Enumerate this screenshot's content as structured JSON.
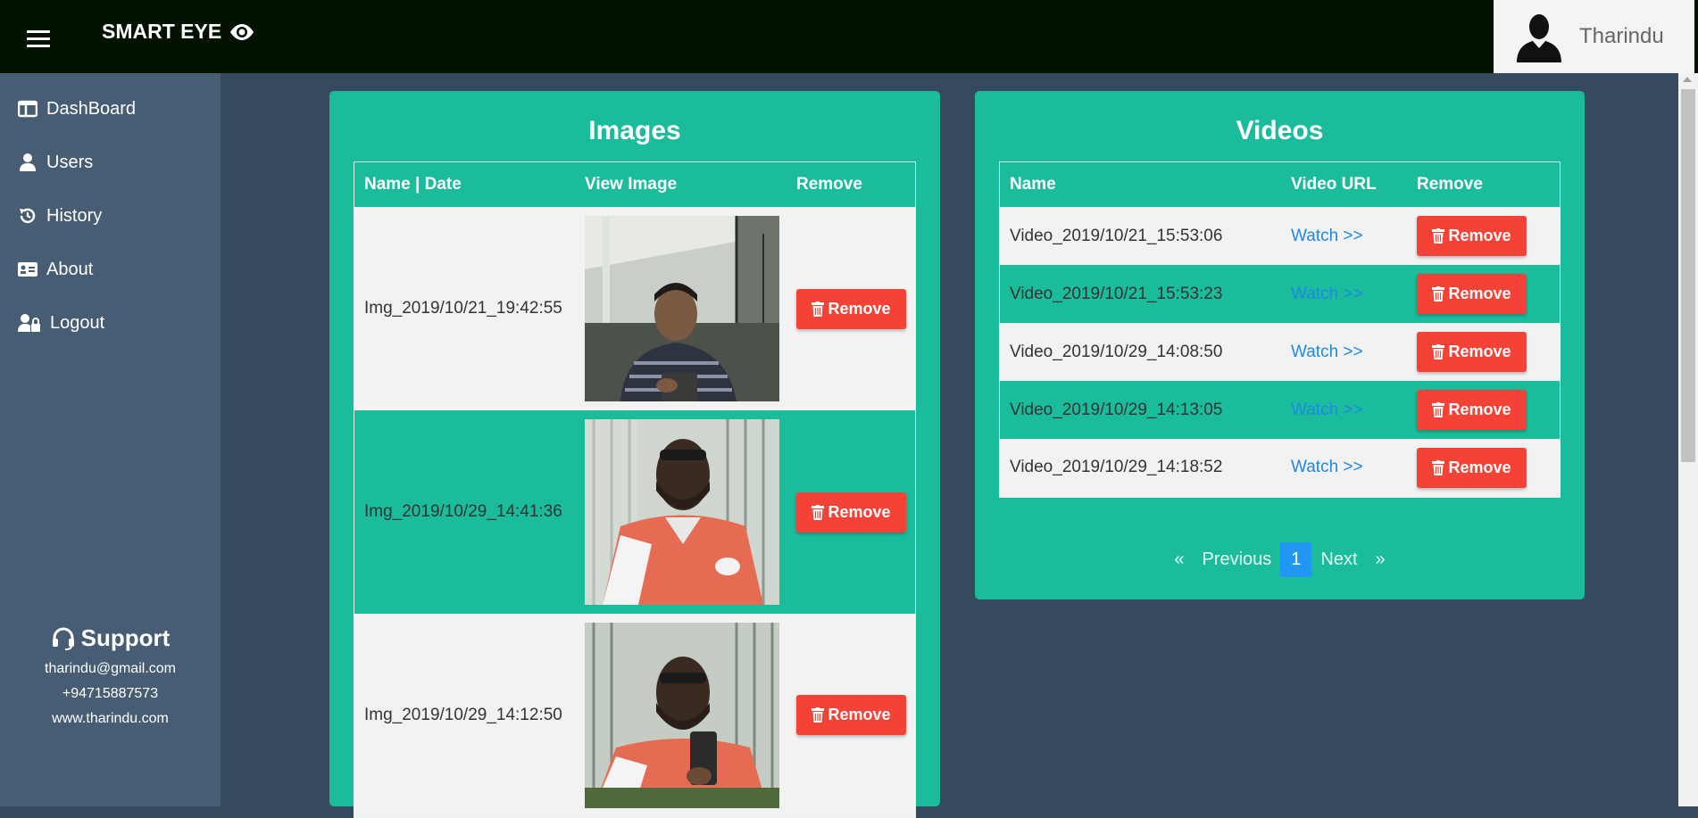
{
  "header": {
    "brand": "SMART EYE",
    "user_name": "Tharindu"
  },
  "sidebar": {
    "items": [
      {
        "label": "DashBoard",
        "icon": "dashboard-icon"
      },
      {
        "label": "Users",
        "icon": "user-icon"
      },
      {
        "label": "History",
        "icon": "history-icon"
      },
      {
        "label": "About",
        "icon": "id-card-icon"
      },
      {
        "label": "Logout",
        "icon": "user-lock-icon"
      }
    ],
    "support": {
      "title": "Support",
      "email": "tharindu@gmail.com",
      "phone": "+94715887573",
      "website": "www.tharindu.com"
    }
  },
  "images": {
    "title": "Images",
    "headers": [
      "Name | Date",
      "View Image",
      "Remove"
    ],
    "rows": [
      {
        "name": "Img_2019/10/21_19:42:55",
        "remove": "Remove"
      },
      {
        "name": "Img_2019/10/29_14:41:36",
        "remove": "Remove"
      },
      {
        "name": "Img_2019/10/29_14:12:50",
        "remove": "Remove"
      }
    ]
  },
  "videos": {
    "title": "Videos",
    "headers": [
      "Name",
      "Video URL",
      "Remove"
    ],
    "rows": [
      {
        "name": "Video_2019/10/21_15:53:06",
        "link": "Watch >>",
        "remove": "Remove"
      },
      {
        "name": "Video_2019/10/21_15:53:23",
        "link": "Watch >>",
        "remove": "Remove"
      },
      {
        "name": "Video_2019/10/29_14:08:50",
        "link": "Watch >>",
        "remove": "Remove"
      },
      {
        "name": "Video_2019/10/29_14:13:05",
        "link": "Watch >>",
        "remove": "Remove"
      },
      {
        "name": "Video_2019/10/29_14:18:52",
        "link": "Watch >>",
        "remove": "Remove"
      }
    ],
    "pagination": {
      "prev_arrow": "«",
      "prev": "Previous",
      "current": "1",
      "next": "Next",
      "next_arrow": "»"
    }
  },
  "colors": {
    "topbar": "#041300",
    "sidebar": "#475d73",
    "content": "#354a5f",
    "card": "#1abc9c",
    "remove": "#f44336",
    "link": "#1e88e5",
    "active_page": "#2196f3"
  }
}
